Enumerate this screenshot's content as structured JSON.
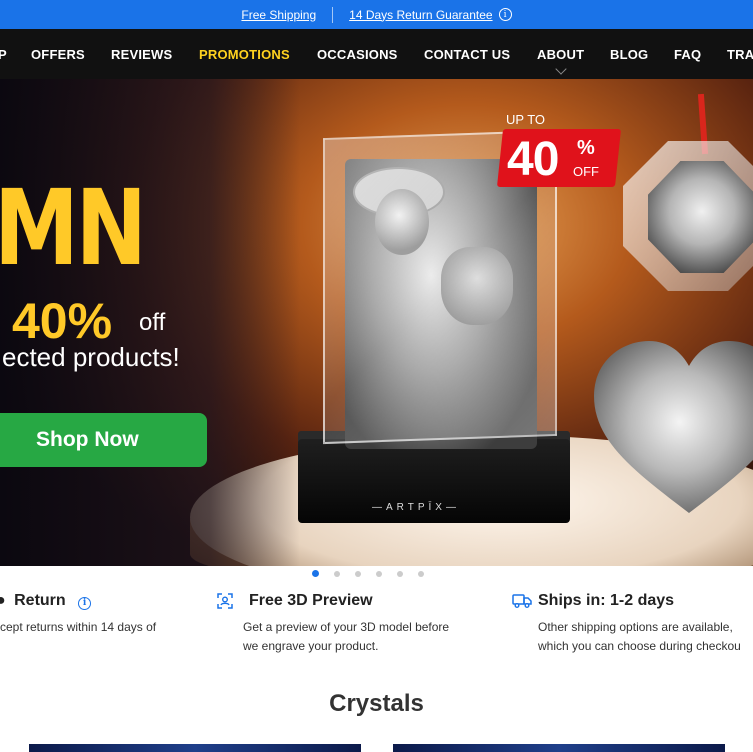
{
  "promo_bar": {
    "free_shipping": "Free Shipping",
    "return_guarantee": "14 Days Return Guarantee",
    "info_icon": "info-circle-icon"
  },
  "nav": {
    "items": [
      {
        "label": "P"
      },
      {
        "label": "OFFERS"
      },
      {
        "label": "REVIEWS"
      },
      {
        "label": "PROMOTIONS"
      },
      {
        "label": "OCCASIONS"
      },
      {
        "label": "CONTACT US"
      },
      {
        "label": "ABOUT"
      },
      {
        "label": "BLOG"
      },
      {
        "label": "FAQ"
      },
      {
        "label": "TRA"
      }
    ]
  },
  "hero": {
    "headline_fragment": "MN",
    "percent": "40%",
    "off": "off",
    "subline": "ected products!",
    "shop_now": "Shop Now",
    "badge_upto": "UP TO",
    "badge_number": "40",
    "badge_percent": "%",
    "badge_off": "OFF",
    "brand": "—ARTPĪX—"
  },
  "carousel": {
    "slide_count": 6,
    "active_index": 0
  },
  "features": {
    "return": {
      "title": "Return",
      "desc": "cept returns within 14 days of"
    },
    "preview": {
      "title": "Free 3D Preview",
      "desc_line1": "Get a preview of your 3D model before",
      "desc_line2": "we engrave your product."
    },
    "ships": {
      "title": "Ships in: 1-2 days",
      "desc_line1": "Other shipping options are available,",
      "desc_line2": "which you can choose during checkou"
    }
  },
  "section": {
    "title": "Crystals"
  },
  "colors": {
    "promo_bar": "#1a73e8",
    "nav_bg": "#111111",
    "nav_active": "#ffd21f",
    "shop_button": "#27a844",
    "badge": "#e0121b",
    "feature_icon": "#1a73e8"
  }
}
